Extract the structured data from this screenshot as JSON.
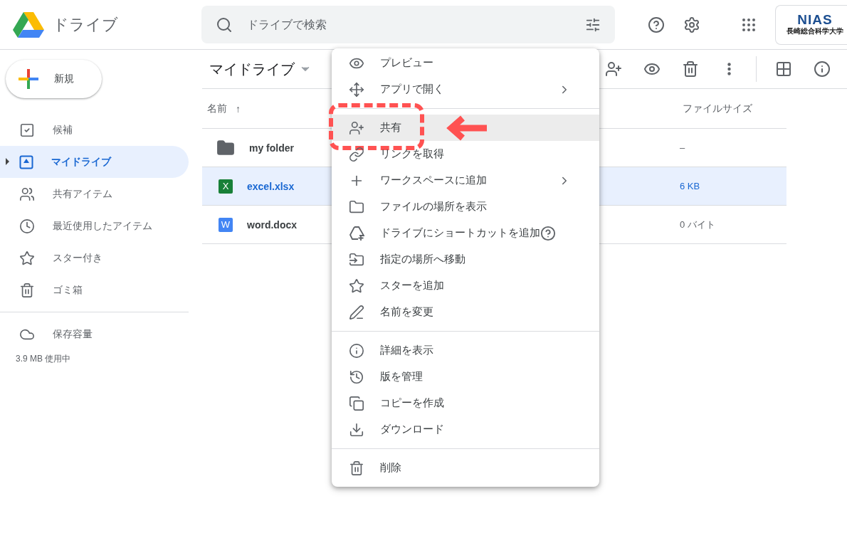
{
  "header": {
    "app_name": "ドライブ",
    "search": {
      "placeholder": "ドライブで検索"
    },
    "org_logo": {
      "mark": "NIAS",
      "name": "長崎総合科学大学"
    }
  },
  "new_button": {
    "label": "新規"
  },
  "sidebar": {
    "items": [
      {
        "label": "候補",
        "selected": false
      },
      {
        "label": "マイドライブ",
        "selected": true
      },
      {
        "label": "共有アイテム",
        "selected": false
      },
      {
        "label": "最近使用したアイテム",
        "selected": false
      },
      {
        "label": "スター付き",
        "selected": false
      },
      {
        "label": "ゴミ箱",
        "selected": false
      }
    ],
    "storage": {
      "label": "保存容量",
      "usage": "3.9 MB 使用中"
    }
  },
  "toolbar": {
    "title": "マイドライブ"
  },
  "table": {
    "columns": [
      "名前",
      "ファイルサイズ"
    ],
    "sort_arrow": "↑",
    "rows": [
      {
        "kind": "folder",
        "name": "my folder",
        "size": "–",
        "selected": false
      },
      {
        "kind": "sheet",
        "badge": "X",
        "name": "excel.xlsx",
        "size": "6 KB",
        "selected": true
      },
      {
        "kind": "doc",
        "badge": "W",
        "name": "word.docx",
        "size": "0 バイト",
        "selected": false
      }
    ]
  },
  "context_menu": {
    "groups": [
      [
        {
          "label": "プレビュー",
          "submenu": false,
          "help": false,
          "highlighted": false
        },
        {
          "label": "アプリで開く",
          "submenu": true,
          "help": false,
          "highlighted": false
        }
      ],
      [
        {
          "label": "共有",
          "submenu": false,
          "help": false,
          "highlighted": true
        },
        {
          "label": "リンクを取得",
          "submenu": false,
          "help": false,
          "highlighted": false
        },
        {
          "label": "ワークスペースに追加",
          "submenu": true,
          "help": false,
          "highlighted": false
        },
        {
          "label": "ファイルの場所を表示",
          "submenu": false,
          "help": false,
          "highlighted": false
        },
        {
          "label": "ドライブにショートカットを追加",
          "submenu": false,
          "help": true,
          "highlighted": false
        },
        {
          "label": "指定の場所へ移動",
          "submenu": false,
          "help": false,
          "highlighted": false
        },
        {
          "label": "スターを追加",
          "submenu": false,
          "help": false,
          "highlighted": false
        },
        {
          "label": "名前を変更",
          "submenu": false,
          "help": false,
          "highlighted": false
        }
      ],
      [
        {
          "label": "詳細を表示",
          "submenu": false,
          "help": false,
          "highlighted": false
        },
        {
          "label": "版を管理",
          "submenu": false,
          "help": false,
          "highlighted": false
        },
        {
          "label": "コピーを作成",
          "submenu": false,
          "help": false,
          "highlighted": false
        },
        {
          "label": "ダウンロード",
          "submenu": false,
          "help": false,
          "highlighted": false
        }
      ],
      [
        {
          "label": "削除",
          "submenu": false,
          "help": false,
          "highlighted": false
        }
      ]
    ]
  }
}
